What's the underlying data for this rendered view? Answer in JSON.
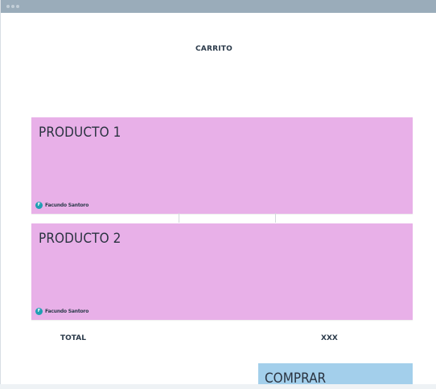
{
  "page": {
    "title": "CARRITO"
  },
  "products": [
    {
      "title": "PRODUCTO 1",
      "author": {
        "name": "Facundo Santoro",
        "initial": "F"
      }
    },
    {
      "title": "PRODUCTO 2",
      "author": {
        "name": "Facundo Santoro",
        "initial": "F"
      }
    }
  ],
  "summary": {
    "total_label": "TOTAL",
    "total_value": "XXX"
  },
  "actions": {
    "buy_label": "COMPRAR"
  },
  "colors": {
    "card_bg": "#e8b0e8",
    "button_bg": "#a3cfeb",
    "titlebar": "#9aacba",
    "avatar": "#1f9fb3"
  }
}
